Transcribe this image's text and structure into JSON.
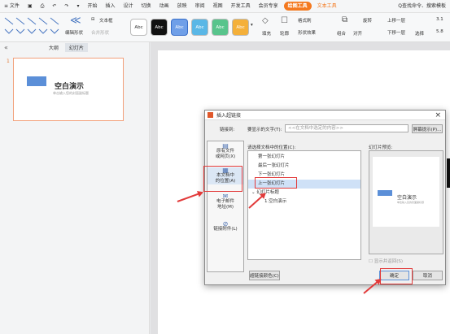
{
  "menubar": {
    "items": [
      "≡ 文件",
      "",
      "",
      "",
      "",
      "",
      "开始",
      "插入",
      "设计",
      "切换",
      "动画",
      "放映",
      "审阅",
      "视图",
      "开发工具",
      "会员专享"
    ],
    "pills": [
      "绘图工具",
      "文本工具"
    ],
    "search": "Q查找命令、搜索模板"
  },
  "ribbon": {
    "edit_shape": "编辑形状",
    "textbox": "文本框",
    "merge_shape": "合并形状",
    "swatches": [
      "Abc",
      "Abc",
      "Abc",
      "Abc",
      "Abc",
      "Abc"
    ],
    "fill": "填充",
    "outline": "轮廓",
    "format_painter": "格式刷",
    "shape_effect": "形状效果",
    "combine": "组合",
    "align": "对齐",
    "rotate": "旋转",
    "up_layer": "上移一层",
    "down_layer": "下移一层",
    "select": "选择",
    "size1": "3.1",
    "size2": "5.8",
    "colors": {
      "sw0": "#ffffff",
      "sw1": "#111111",
      "sw2": "#6f9fe8",
      "sw3": "#5ab7e6",
      "sw4": "#58c48c",
      "sw5": "#f4b03a"
    }
  },
  "panel": {
    "collapse": "«",
    "tab_outline": "大纲",
    "tab_slides": "幻灯片",
    "slide_number": "1",
    "thumb_title": "空白演示",
    "thumb_subtitle": "单击输入您的封面副标题"
  },
  "dialog": {
    "title": "插入超链接",
    "link_to": "链接到:",
    "display_text_label": "要显示的文字(T):",
    "display_text_placeholder": "<<在文档中选定的内容>>",
    "screen_tip": "屏幕提示(P)...",
    "place_label": "请选择文档中的位置(C):",
    "preview_label": "幻灯片预览:",
    "side": [
      {
        "label": "原有文件\n或网页(X)"
      },
      {
        "label": "本文档中\n的位置(A)"
      },
      {
        "label": "电子邮件\n地址(M)"
      },
      {
        "label": "链接附件(L)"
      }
    ],
    "places": [
      "第一张幻灯片",
      "最后一张幻灯片",
      "下一张幻灯片",
      "上一张幻灯片",
      "幻灯片标题",
      "1.空白演示"
    ],
    "preview_title": "空白演示",
    "preview_subtitle": "单击输入您的封面副标题",
    "show_return": "显示并返回(S)",
    "link_color": "超链接颜色(C)",
    "ok": "确定",
    "cancel": "取消",
    "close": "×"
  }
}
